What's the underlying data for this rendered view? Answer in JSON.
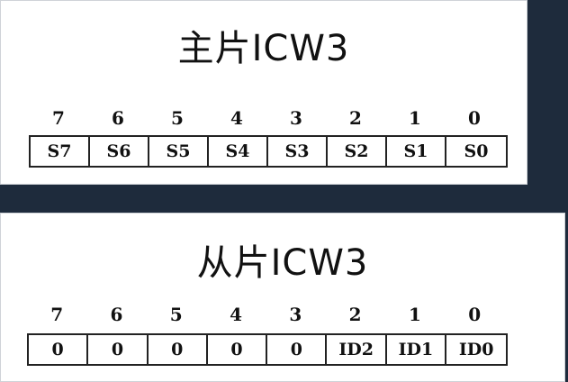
{
  "master": {
    "title": "主片ICW3",
    "bits": [
      "7",
      "6",
      "5",
      "4",
      "3",
      "2",
      "1",
      "0"
    ],
    "cells": [
      "S7",
      "S6",
      "S5",
      "S4",
      "S3",
      "S2",
      "S1",
      "S0"
    ]
  },
  "slave": {
    "title": "从片ICW3",
    "bits": [
      "7",
      "6",
      "5",
      "4",
      "3",
      "2",
      "1",
      "0"
    ],
    "cells": [
      "0",
      "0",
      "0",
      "0",
      "0",
      "ID2",
      "ID1",
      "ID0"
    ]
  },
  "colors": {
    "background": "#1e2b3c",
    "panel": "#ffffff",
    "ink": "#111111"
  }
}
